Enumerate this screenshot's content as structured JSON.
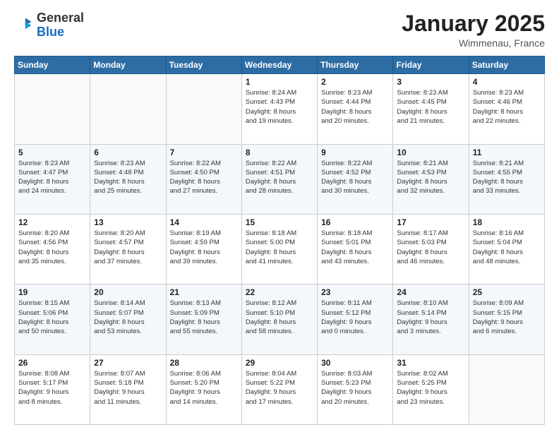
{
  "logo": {
    "general": "General",
    "blue": "Blue"
  },
  "header": {
    "month": "January 2025",
    "location": "Wimmenau, France"
  },
  "weekdays": [
    "Sunday",
    "Monday",
    "Tuesday",
    "Wednesday",
    "Thursday",
    "Friday",
    "Saturday"
  ],
  "weeks": [
    [
      {
        "day": "",
        "info": ""
      },
      {
        "day": "",
        "info": ""
      },
      {
        "day": "",
        "info": ""
      },
      {
        "day": "1",
        "info": "Sunrise: 8:24 AM\nSunset: 4:43 PM\nDaylight: 8 hours\nand 19 minutes."
      },
      {
        "day": "2",
        "info": "Sunrise: 8:23 AM\nSunset: 4:44 PM\nDaylight: 8 hours\nand 20 minutes."
      },
      {
        "day": "3",
        "info": "Sunrise: 8:23 AM\nSunset: 4:45 PM\nDaylight: 8 hours\nand 21 minutes."
      },
      {
        "day": "4",
        "info": "Sunrise: 8:23 AM\nSunset: 4:46 PM\nDaylight: 8 hours\nand 22 minutes."
      }
    ],
    [
      {
        "day": "5",
        "info": "Sunrise: 8:23 AM\nSunset: 4:47 PM\nDaylight: 8 hours\nand 24 minutes."
      },
      {
        "day": "6",
        "info": "Sunrise: 8:23 AM\nSunset: 4:48 PM\nDaylight: 8 hours\nand 25 minutes."
      },
      {
        "day": "7",
        "info": "Sunrise: 8:22 AM\nSunset: 4:50 PM\nDaylight: 8 hours\nand 27 minutes."
      },
      {
        "day": "8",
        "info": "Sunrise: 8:22 AM\nSunset: 4:51 PM\nDaylight: 8 hours\nand 28 minutes."
      },
      {
        "day": "9",
        "info": "Sunrise: 8:22 AM\nSunset: 4:52 PM\nDaylight: 8 hours\nand 30 minutes."
      },
      {
        "day": "10",
        "info": "Sunrise: 8:21 AM\nSunset: 4:53 PM\nDaylight: 8 hours\nand 32 minutes."
      },
      {
        "day": "11",
        "info": "Sunrise: 8:21 AM\nSunset: 4:55 PM\nDaylight: 8 hours\nand 33 minutes."
      }
    ],
    [
      {
        "day": "12",
        "info": "Sunrise: 8:20 AM\nSunset: 4:56 PM\nDaylight: 8 hours\nand 35 minutes."
      },
      {
        "day": "13",
        "info": "Sunrise: 8:20 AM\nSunset: 4:57 PM\nDaylight: 8 hours\nand 37 minutes."
      },
      {
        "day": "14",
        "info": "Sunrise: 8:19 AM\nSunset: 4:59 PM\nDaylight: 8 hours\nand 39 minutes."
      },
      {
        "day": "15",
        "info": "Sunrise: 8:18 AM\nSunset: 5:00 PM\nDaylight: 8 hours\nand 41 minutes."
      },
      {
        "day": "16",
        "info": "Sunrise: 8:18 AM\nSunset: 5:01 PM\nDaylight: 8 hours\nand 43 minutes."
      },
      {
        "day": "17",
        "info": "Sunrise: 8:17 AM\nSunset: 5:03 PM\nDaylight: 8 hours\nand 46 minutes."
      },
      {
        "day": "18",
        "info": "Sunrise: 8:16 AM\nSunset: 5:04 PM\nDaylight: 8 hours\nand 48 minutes."
      }
    ],
    [
      {
        "day": "19",
        "info": "Sunrise: 8:15 AM\nSunset: 5:06 PM\nDaylight: 8 hours\nand 50 minutes."
      },
      {
        "day": "20",
        "info": "Sunrise: 8:14 AM\nSunset: 5:07 PM\nDaylight: 8 hours\nand 53 minutes."
      },
      {
        "day": "21",
        "info": "Sunrise: 8:13 AM\nSunset: 5:09 PM\nDaylight: 8 hours\nand 55 minutes."
      },
      {
        "day": "22",
        "info": "Sunrise: 8:12 AM\nSunset: 5:10 PM\nDaylight: 8 hours\nand 58 minutes."
      },
      {
        "day": "23",
        "info": "Sunrise: 8:11 AM\nSunset: 5:12 PM\nDaylight: 9 hours\nand 0 minutes."
      },
      {
        "day": "24",
        "info": "Sunrise: 8:10 AM\nSunset: 5:14 PM\nDaylight: 9 hours\nand 3 minutes."
      },
      {
        "day": "25",
        "info": "Sunrise: 8:09 AM\nSunset: 5:15 PM\nDaylight: 9 hours\nand 6 minutes."
      }
    ],
    [
      {
        "day": "26",
        "info": "Sunrise: 8:08 AM\nSunset: 5:17 PM\nDaylight: 9 hours\nand 8 minutes."
      },
      {
        "day": "27",
        "info": "Sunrise: 8:07 AM\nSunset: 5:18 PM\nDaylight: 9 hours\nand 11 minutes."
      },
      {
        "day": "28",
        "info": "Sunrise: 8:06 AM\nSunset: 5:20 PM\nDaylight: 9 hours\nand 14 minutes."
      },
      {
        "day": "29",
        "info": "Sunrise: 8:04 AM\nSunset: 5:22 PM\nDaylight: 9 hours\nand 17 minutes."
      },
      {
        "day": "30",
        "info": "Sunrise: 8:03 AM\nSunset: 5:23 PM\nDaylight: 9 hours\nand 20 minutes."
      },
      {
        "day": "31",
        "info": "Sunrise: 8:02 AM\nSunset: 5:25 PM\nDaylight: 9 hours\nand 23 minutes."
      },
      {
        "day": "",
        "info": ""
      }
    ]
  ]
}
